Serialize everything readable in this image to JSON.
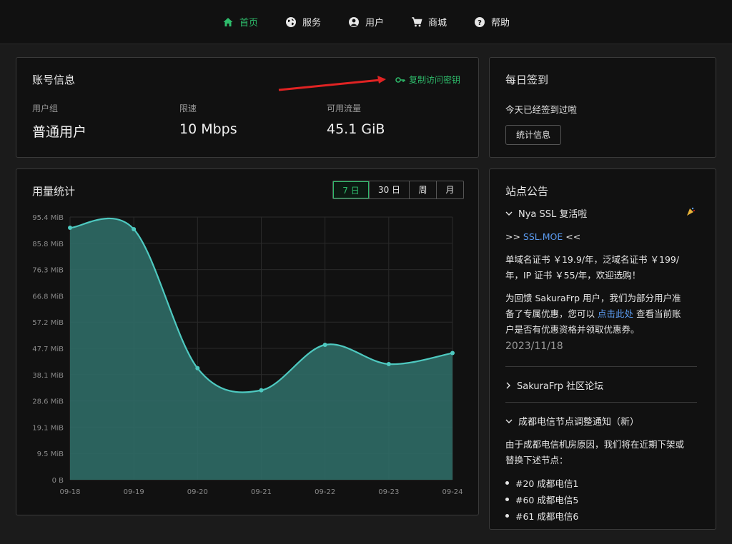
{
  "nav": [
    {
      "label": "首页",
      "icon": "home-icon",
      "active": true
    },
    {
      "label": "服务",
      "icon": "globe-icon",
      "active": false
    },
    {
      "label": "用户",
      "icon": "user-icon",
      "active": false
    },
    {
      "label": "商城",
      "icon": "cart-icon",
      "active": false
    },
    {
      "label": "帮助",
      "icon": "help-icon",
      "active": false
    }
  ],
  "account": {
    "title": "账号信息",
    "copy_key_label": "复制访问密钥",
    "stats": [
      {
        "label": "用户组",
        "value": "普通用户"
      },
      {
        "label": "限速",
        "value": "10 Mbps"
      },
      {
        "label": "可用流量",
        "value": "45.1 GiB"
      }
    ]
  },
  "checkin": {
    "title": "每日签到",
    "status": "今天已经签到过啦",
    "button": "统计信息"
  },
  "usage": {
    "title": "用量统计",
    "ranges": [
      "7 日",
      "30 日",
      "周",
      "月"
    ],
    "active_range": "7 日"
  },
  "chart_data": {
    "type": "area",
    "categories": [
      "09-18",
      "09-19",
      "09-20",
      "09-21",
      "09-22",
      "09-23",
      "09-24"
    ],
    "values": [
      91.5,
      91,
      40.5,
      32.5,
      49,
      42,
      46
    ],
    "y_ticks": [
      "0 B",
      "9.5 MiB",
      "19.1 MiB",
      "28.6 MiB",
      "38.1 MiB",
      "47.7 MiB",
      "57.2 MiB",
      "66.8 MiB",
      "76.3 MiB",
      "85.8 MiB",
      "95.4 MiB"
    ],
    "ylim": [
      0,
      95.4
    ],
    "grid": true,
    "colors": {
      "line": "#4ec9c0",
      "fill": "#2f6b66"
    }
  },
  "notice": {
    "title": "站点公告",
    "sec1": {
      "title": "Nya SSL 复活啦",
      "link_pre": ">> ",
      "link": "SSL.MOE",
      "link_post": " <<",
      "p1": "单域名证书 ￥19.9/年，泛域名证书 ￥199/年，IP 证书 ￥55/年，欢迎选购！",
      "p2_a": "为回馈 SakuraFrp 用户，我们为部分用户准备了专属优惠，您可以 ",
      "p2_link": "点击此处",
      "p2_b": " 查看当前账户是否有优惠资格并领取优惠券。",
      "date": "2023/11/18"
    },
    "sec2": {
      "title": "SakuraFrp 社区论坛"
    },
    "sec3": {
      "title": "成都电信节点调整通知（新）",
      "p": "由于成都电信机房原因，我们将在近期下架或替换下述节点：",
      "items": [
        "#20 成都电信1",
        "#60 成都电信5",
        "#61 成都电信6"
      ]
    }
  }
}
